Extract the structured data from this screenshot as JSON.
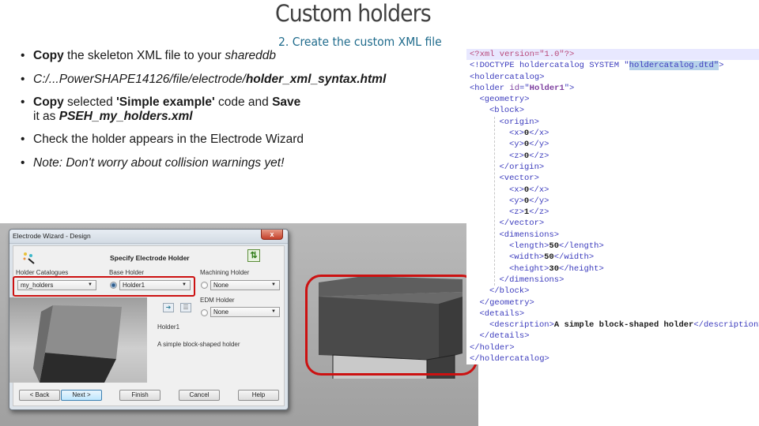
{
  "slide": {
    "title": "Custom holders",
    "subtitle": "2. Create the custom XML file"
  },
  "bullets": [
    {
      "parts": [
        {
          "text": "Copy",
          "style": "b"
        },
        {
          "text": " the skeleton XML file to your ",
          "style": ""
        },
        {
          "text": "shareddb",
          "style": "i"
        }
      ]
    },
    {
      "parts": [
        {
          "text": "C:/...PowerSHAPE14126/file/electrode/",
          "style": "i"
        },
        {
          "text": "holder_xml_syntax.html",
          "style": "b i"
        }
      ]
    },
    {
      "parts": [
        {
          "text": "Copy",
          "style": "b"
        },
        {
          "text": " selected ",
          "style": ""
        },
        {
          "text": "'Simple example'",
          "style": "b"
        },
        {
          "text": " code and ",
          "style": ""
        },
        {
          "text": "Save",
          "style": "b"
        },
        {
          "text": " it as  ",
          "style": ""
        },
        {
          "text": "PSEH_my_holders.xml",
          "style": "b i"
        }
      ]
    },
    {
      "parts": [
        {
          "text": "Check the holder appears in the Electrode Wizard",
          "style": ""
        }
      ]
    },
    {
      "parts": [
        {
          "text": "Note: Don't worry about collision warnings yet!",
          "style": "i"
        }
      ]
    }
  ],
  "dialog": {
    "title": "Electrode Wizard - Design",
    "close_label": "x",
    "heading": "Specify Electrode Holder",
    "holder_catalogues_label": "Holder Catalogues",
    "holder_catalogues_value": "my_holders",
    "base_holder_label": "Base Holder",
    "base_holder_value": "Holder1",
    "machining_holder_label": "Machining Holder",
    "machining_holder_value": "None",
    "edm_holder_label": "EDM Holder",
    "edm_holder_value": "None",
    "holder_name": "Holder1",
    "holder_description": "A simple block-shaped holder",
    "buttons": {
      "back": "< Back",
      "next": "Next >",
      "finish": "Finish",
      "cancel": "Cancel",
      "help": "Help"
    },
    "icons": {
      "wizard": "wizard-wand-icon",
      "sort": "sort-arrows-icon",
      "transfer": "transfer-arrow-icon",
      "list": "list-icon"
    }
  },
  "xml": {
    "lines": [
      {
        "indent": 0,
        "html": "<span class=\"pi\">&lt;?xml version=\"1.0\"?&gt;</span>",
        "current": true
      },
      {
        "indent": 0,
        "html": "<span class=\"tag\">&lt;!DOCTYPE holdercatalog SYSTEM \"<span class=\"sel\">holdercatalog.dtd\"</span>&gt;</span>"
      },
      {
        "indent": 0,
        "html": "<span class=\"tag\">&lt;holdercatalog&gt;</span>"
      },
      {
        "indent": 0,
        "html": "<span class=\"tag\">&lt;holder <span class=\"attr\">id</span>=\"<span class=\"attr\" style=\"font-weight:bold\">Holder1</span>\"&gt;</span>"
      },
      {
        "indent": 1,
        "html": "<span class=\"tag\">&lt;geometry&gt;</span>"
      },
      {
        "indent": 2,
        "html": "<span class=\"tag\">&lt;block&gt;</span>"
      },
      {
        "indent": 3,
        "html": "<span class=\"tag\">&lt;origin&gt;</span>"
      },
      {
        "indent": 4,
        "html": "<span class=\"tag\">&lt;x&gt;</span><span class=\"val\">0</span><span class=\"tag\">&lt;/x&gt;</span>"
      },
      {
        "indent": 4,
        "html": "<span class=\"tag\">&lt;y&gt;</span><span class=\"val\">0</span><span class=\"tag\">&lt;/y&gt;</span>"
      },
      {
        "indent": 4,
        "html": "<span class=\"tag\">&lt;z&gt;</span><span class=\"val\">0</span><span class=\"tag\">&lt;/z&gt;</span>"
      },
      {
        "indent": 3,
        "html": "<span class=\"tag\">&lt;/origin&gt;</span>"
      },
      {
        "indent": 3,
        "html": "<span class=\"tag\">&lt;vector&gt;</span>"
      },
      {
        "indent": 4,
        "html": "<span class=\"tag\">&lt;x&gt;</span><span class=\"val\">0</span><span class=\"tag\">&lt;/x&gt;</span>"
      },
      {
        "indent": 4,
        "html": "<span class=\"tag\">&lt;y&gt;</span><span class=\"val\">0</span><span class=\"tag\">&lt;/y&gt;</span>"
      },
      {
        "indent": 4,
        "html": "<span class=\"tag\">&lt;z&gt;</span><span class=\"val\">1</span><span class=\"tag\">&lt;/z&gt;</span>"
      },
      {
        "indent": 3,
        "html": "<span class=\"tag\">&lt;/vector&gt;</span>"
      },
      {
        "indent": 3,
        "html": "<span class=\"tag\">&lt;dimensions&gt;</span>"
      },
      {
        "indent": 4,
        "html": "<span class=\"tag\">&lt;length&gt;</span><span class=\"val\">50</span><span class=\"tag\">&lt;/length&gt;</span>"
      },
      {
        "indent": 4,
        "html": "<span class=\"tag\">&lt;width&gt;</span><span class=\"val\">50</span><span class=\"tag\">&lt;/width&gt;</span>"
      },
      {
        "indent": 4,
        "html": "<span class=\"tag\">&lt;height&gt;</span><span class=\"val\">30</span><span class=\"tag\">&lt;/height&gt;</span>"
      },
      {
        "indent": 3,
        "html": "<span class=\"tag\">&lt;/dimensions&gt;</span>"
      },
      {
        "indent": 2,
        "html": "<span class=\"tag\">&lt;/block&gt;</span>"
      },
      {
        "indent": 1,
        "html": "<span class=\"tag\">&lt;/geometry&gt;</span>"
      },
      {
        "indent": 1,
        "html": "<span class=\"tag\">&lt;details&gt;</span>"
      },
      {
        "indent": 2,
        "html": "<span class=\"tag\">&lt;description&gt;</span><span class=\"val\">A simple block-shaped holder</span><span class=\"tag\">&lt;/description&gt;</span>"
      },
      {
        "indent": 1,
        "html": "<span class=\"tag\">&lt;/details&gt;</span>"
      },
      {
        "indent": 0,
        "html": "<span class=\"tag\">&lt;/holder&gt;</span>"
      },
      {
        "indent": 0,
        "html": "<span class=\"tag\">&lt;/holdercatalog&gt;</span>"
      }
    ]
  },
  "colors": {
    "highlight_red": "#cc1111",
    "subtitle_blue": "#1f6b8c",
    "title_grey": "#404040"
  }
}
